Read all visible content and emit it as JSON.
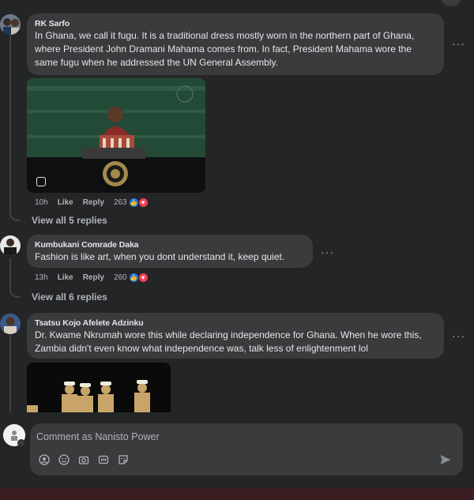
{
  "comments": [
    {
      "author": "RK Sarfo",
      "text": "In Ghana, we call it fugu. It is a traditional dress mostly worn in the northern part of Ghana, where President John Dramani Mahama comes from. In fact, President Mahama wore the same fugu when he addressed the UN General Assembly.",
      "time": "10h",
      "like_label": "Like",
      "reply_label": "Reply",
      "reaction_count": "263",
      "view_replies": "View all 5 replies"
    },
    {
      "author": "Kumbukani Comrade Daka",
      "text": "Fashion is like art, when you dont understand it, keep quiet.",
      "time": "13h",
      "like_label": "Like",
      "reply_label": "Reply",
      "reaction_count": "260",
      "view_replies": "View all 6 replies"
    },
    {
      "author": "Tsatsu Kojo Afelete Adzinku",
      "text": "Dr. Kwame Nkrumah wore this while declaring independence for Ghana. When he wore this, Zambia didn't even know what independence was, talk less of enlightenment lol"
    }
  ],
  "more_glyph": "···",
  "composer": {
    "placeholder": "Comment as Nanisto Power"
  },
  "icons": {
    "like": "thumbs-up-icon",
    "love": "heart-icon",
    "more": "more-options-icon",
    "send": "send-icon",
    "tools": [
      "avatar-sticker-icon",
      "emoji-icon",
      "camera-icon",
      "gif-icon",
      "sticker-icon"
    ]
  },
  "colors": {
    "background": "#242526",
    "bubble": "#3a3b3c",
    "like_blue": "#1877f2",
    "love_red": "#f33e58",
    "muted_text": "#b0b3b8"
  }
}
